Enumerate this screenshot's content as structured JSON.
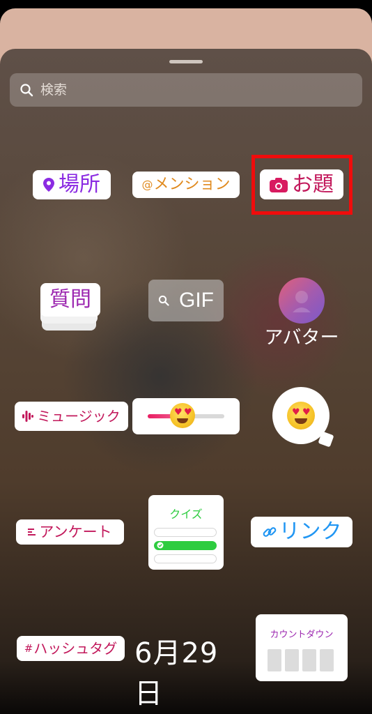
{
  "search": {
    "placeholder": "検索"
  },
  "stickers": {
    "location": "場所",
    "mention": "@メンション",
    "mention_prefix": "@",
    "mention_text": "メンション",
    "topic": "お題",
    "questions": "質問",
    "gif": "GIF",
    "avatar": "アバター",
    "music": "ミュージック",
    "poll": "アンケート",
    "quiz_title": "クイズ",
    "link": "リンク",
    "hashtag_prefix": "#",
    "hashtag_text": "ハッシュタグ",
    "date": "6月29日",
    "countdown": "カウントダウン"
  },
  "emoji_slider": {
    "emoji": "heart-eyes-face",
    "level": 0.4
  },
  "colors": {
    "highlight": "#f00c0c",
    "purple": "#8b2be2",
    "magenta": "#c2185b",
    "orange": "#e08a1e",
    "link_blue": "#2196f3",
    "quiz_green": "#2ecc40"
  },
  "icons": [
    "search-icon",
    "location-pin-icon",
    "camera-icon",
    "gif-search-icon",
    "music-waveform-icon",
    "poll-lines-icon",
    "link-icon",
    "check-icon"
  ]
}
